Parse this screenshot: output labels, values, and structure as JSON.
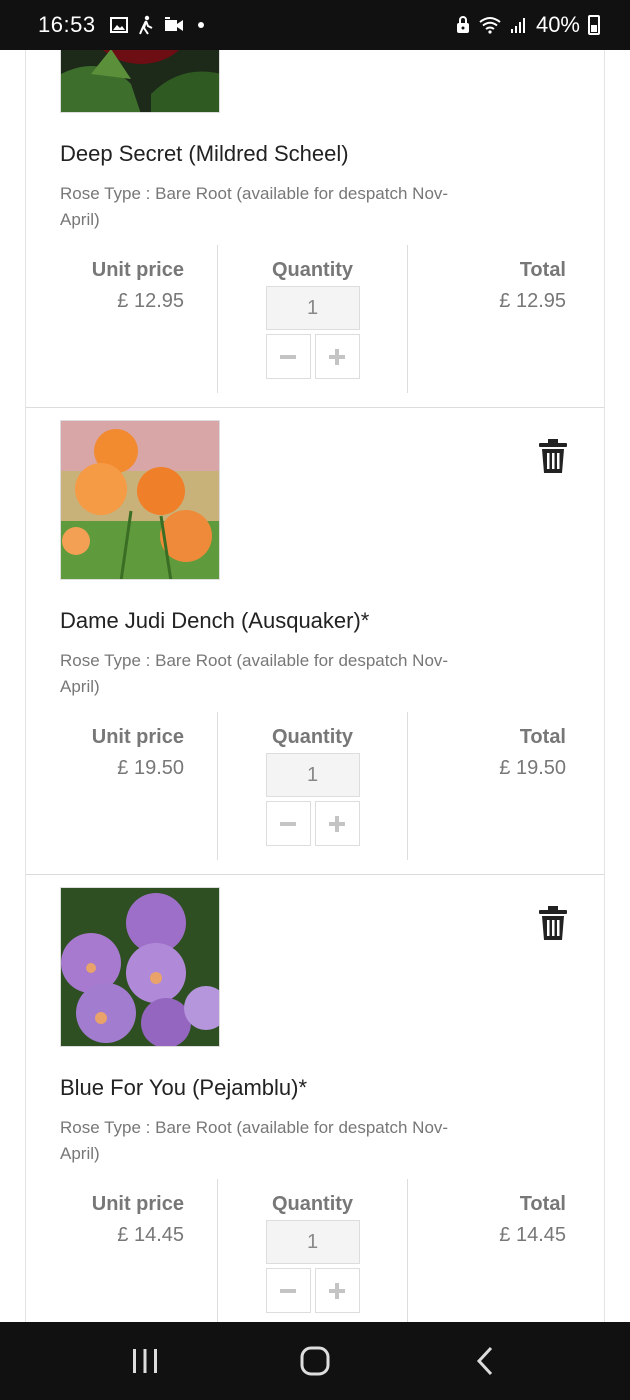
{
  "status_bar": {
    "time": "16:53",
    "battery": "40%",
    "left_icons": [
      "gallery-icon",
      "activity-icon",
      "video-icon",
      "notification-dot"
    ],
    "right_icons": [
      "lock-icon",
      "wifi-icon",
      "signal-icon",
      "battery-icon"
    ]
  },
  "labels": {
    "unit_price": "Unit price",
    "quantity": "Quantity",
    "total": "Total"
  },
  "items": [
    {
      "name": "Deep Secret (Mildred Scheel)",
      "rose_type": "Rose Type : Bare Root (available for despatch Nov-April)",
      "unit_price": "£ 12.95",
      "quantity": "1",
      "total": "£ 12.95",
      "image_color": "#7a0f16"
    },
    {
      "name": "Dame Judi Dench (Ausquaker)*",
      "rose_type": "Rose Type : Bare Root (available for despatch Nov-April)",
      "unit_price": "£ 19.50",
      "quantity": "1",
      "total": "£ 19.50",
      "image_color": "#f08a3a"
    },
    {
      "name": "Blue For You (Pejamblu)*",
      "rose_type": "Rose Type : Bare Root (available for despatch Nov-April)",
      "unit_price": "£ 14.45",
      "quantity": "1",
      "total": "£ 14.45",
      "image_color": "#9b6fc4"
    }
  ],
  "nav": {
    "icons": [
      "recent-apps-icon",
      "home-icon",
      "back-icon"
    ]
  }
}
